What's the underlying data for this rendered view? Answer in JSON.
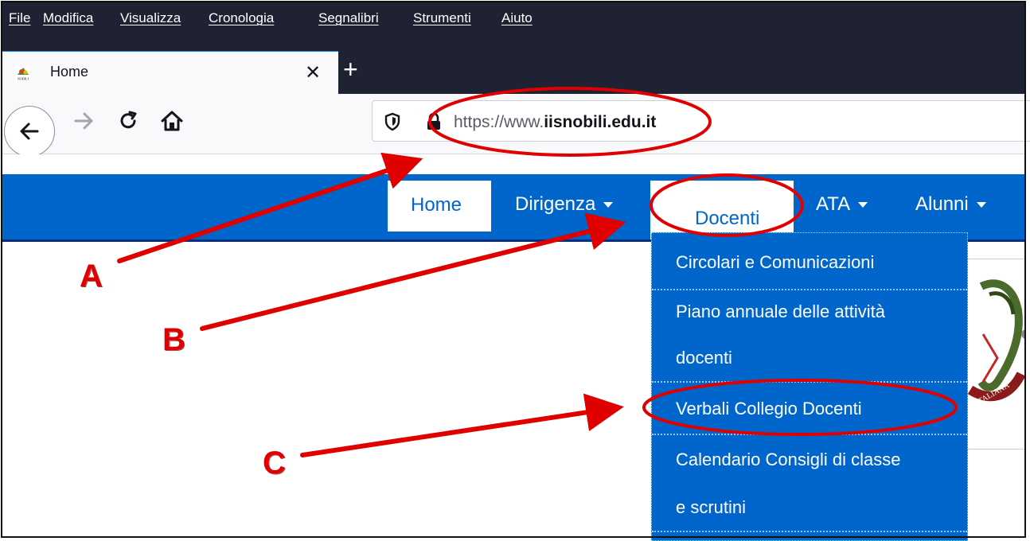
{
  "menubar": {
    "items": [
      {
        "label": "File",
        "key": "F"
      },
      {
        "label": "Modifica",
        "key": "M"
      },
      {
        "label": "Visualizza",
        "key": "V"
      },
      {
        "label": "Cronologia",
        "key": "C"
      },
      {
        "label": "Segnalibri",
        "key": "g"
      },
      {
        "label": "Strumenti",
        "key": "S"
      },
      {
        "label": "Aiuto",
        "key": "A"
      }
    ]
  },
  "tab": {
    "title": "Home",
    "favicon_text": "NOBILI",
    "close_glyph": "✕",
    "newtab_glyph": "+"
  },
  "toolbar": {
    "url_prefix": "https://www.",
    "url_domain": "iisnobili.edu.it"
  },
  "site_nav": {
    "items": [
      "Home",
      "Dirigenza",
      "Docenti",
      "ATA",
      "Alunni"
    ]
  },
  "dropdown": {
    "items": [
      "Circolari e Comunicazioni",
      "Piano annuale delle attività",
      "docenti",
      "Verbali Collegio Docenti",
      "Calendario Consigli di classe",
      "e scrutini"
    ]
  },
  "emblem": {
    "text": "ITALIANA"
  },
  "annotations": {
    "labels": [
      "A",
      "B",
      "C"
    ],
    "color": "#e00000"
  },
  "colors": {
    "menubar": "#1f2233",
    "site_nav": "#0066cc",
    "dropdown": "#0066cc"
  }
}
